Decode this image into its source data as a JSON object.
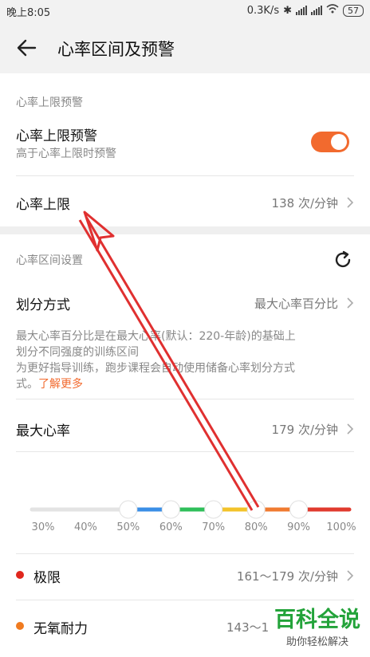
{
  "status_bar": {
    "time": "晚上8:05",
    "speed": "0.3K/s",
    "battery": "57"
  },
  "header": {
    "title": "心率区间及预警"
  },
  "upper_warning": {
    "section_label": "心率上限预警",
    "toggle_title": "心率上限预警",
    "toggle_subtitle": "高于心率上限时预警",
    "toggle_on": true,
    "limit_label": "心率上限",
    "limit_value": "138 次/分钟"
  },
  "zone_settings": {
    "section_label": "心率区间设置",
    "method_label": "划分方式",
    "method_value": "最大心率百分比",
    "description_lines": [
      "最大心率百分比是在最大心率(默认：220-年龄)的基础上",
      "划分不同强度的训练区间",
      "为更好指导训练，跑步课程会自动使用储备心率划分方式",
      "式。"
    ],
    "learn_more": "了解更多",
    "max_hr_label": "最大心率",
    "max_hr_value": "179 次/分钟"
  },
  "slider": {
    "ticks": [
      "30%",
      "40%",
      "50%",
      "60%",
      "70%",
      "80%",
      "90%",
      "100%"
    ],
    "segment_colors": [
      "#e3e3e3",
      "#e3e3e3",
      "#3a8ee6",
      "#2fbf5a",
      "#f3c32a",
      "#f07b30",
      "#e03a2e"
    ]
  },
  "zones": [
    {
      "name": "极限",
      "range": "161～179 次/分钟",
      "color": "#e0271d"
    },
    {
      "name": "无氧耐力",
      "range": "143～1",
      "color": "#f07b20"
    }
  ],
  "watermark": {
    "main": "百科全说",
    "sub": "助你轻松解决"
  }
}
